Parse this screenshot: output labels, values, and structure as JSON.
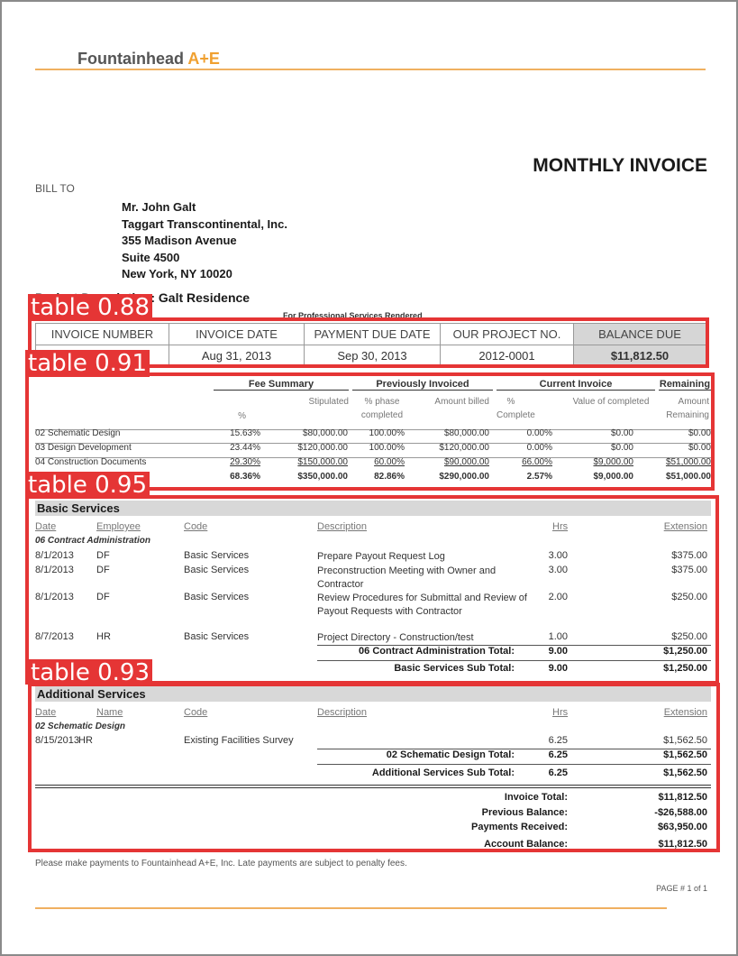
{
  "company": {
    "name": "Fountainhead",
    "accent": "A+E"
  },
  "doc_title": "MONTHLY INVOICE",
  "bill_to_label": "BILL TO",
  "address": [
    "Mr. John Galt",
    "Taggart Transcontinental, Inc.",
    "355 Madison Avenue",
    "Suite 4500",
    "New York,  NY  10020"
  ],
  "project_line": "Project Description: Galt Residence",
  "services_caption": "For Professional Services Rendered",
  "info": {
    "headers": [
      "INVOICE NUMBER",
      "INVOICE DATE",
      "PAYMENT DUE DATE",
      "OUR PROJECT NO.",
      "BALANCE DUE"
    ],
    "values": [
      "",
      "Aug 31, 2013",
      "Sep 30, 2013",
      "2012-0001",
      "$11,812.50"
    ]
  },
  "fee": {
    "groups": [
      "Fee Summary",
      "Previously Invoiced",
      "Current Invoice",
      "Remaining"
    ],
    "subheads": {
      "pct": "%",
      "stipulated": "Stipulated",
      "phase": "% phase completed",
      "amount_billed": "Amount billed",
      "complete": "% Complete",
      "value_completed": "Value of completed",
      "amount_remaining": "Amount Remaining"
    },
    "rows": [
      [
        "02 Schematic Design",
        "15.63%",
        "$80,000.00",
        "100.00%",
        "$80,000.00",
        "0.00%",
        "$0.00",
        "$0.00"
      ],
      [
        "03 Design Development",
        "23.44%",
        "$120,000.00",
        "100.00%",
        "$120,000.00",
        "0.00%",
        "$0.00",
        "$0.00"
      ],
      [
        "04 Construction Documents",
        "29.30%",
        "$150,000.00",
        "60.00%",
        "$90,000.00",
        "66.00%",
        "$9,000.00",
        "$51,000.00"
      ]
    ],
    "total": [
      "",
      "68.36%",
      "$350,000.00",
      "82.86%",
      "$290,000.00",
      "2.57%",
      "$9,000.00",
      "$51,000.00"
    ]
  },
  "basic": {
    "title": "Basic Services",
    "colheads": {
      "date": "Date",
      "employee": "Employee",
      "code": "Code",
      "description": "Description",
      "hrs": "Hrs",
      "extension": "Extension"
    },
    "category": "06 Contract Administration",
    "rows": [
      {
        "date": "8/1/2013",
        "emp": "DF",
        "code": "Basic Services",
        "desc": "Prepare Payout Request Log",
        "hrs": "3.00",
        "ext": "$375.00"
      },
      {
        "date": "8/1/2013",
        "emp": "DF",
        "code": "Basic Services",
        "desc": "Preconstruction Meeting with Owner and Contractor",
        "hrs": "3.00",
        "ext": "$375.00"
      },
      {
        "date": "8/1/2013",
        "emp": "DF",
        "code": "Basic Services",
        "desc": "Review Procedures for Submittal and Review of Payout Requests with Contractor",
        "hrs": "2.00",
        "ext": "$250.00"
      },
      {
        "date": "8/7/2013",
        "emp": "HR",
        "code": "Basic Services",
        "desc": "Project Directory - Construction/test",
        "hrs": "1.00",
        "ext": "$250.00"
      }
    ],
    "cat_total": {
      "label": "06 Contract Administration Total:",
      "hrs": "9.00",
      "ext": "$1,250.00"
    },
    "sub_total": {
      "label": "Basic Services Sub Total:",
      "hrs": "9.00",
      "ext": "$1,250.00"
    }
  },
  "additional": {
    "title": "Additional Services",
    "colheads": {
      "date": "Date",
      "name": "Name",
      "code": "Code",
      "description": "Description",
      "hrs": "Hrs",
      "extension": "Extension"
    },
    "category": "02 Schematic Design",
    "rows": [
      {
        "date": "8/15/2013",
        "emp": "HR",
        "code": "Existing Facilities Survey",
        "desc": "",
        "hrs": "6.25",
        "ext": "$1,562.50"
      }
    ],
    "cat_total": {
      "label": "02 Schematic Design Total:",
      "hrs": "6.25",
      "ext": "$1,562.50"
    },
    "sub_total": {
      "label": "Additional Services Sub Total:",
      "hrs": "6.25",
      "ext": "$1,562.50"
    }
  },
  "summary": {
    "invoice_total": {
      "label": "Invoice Total:",
      "value": "$11,812.50"
    },
    "previous_balance": {
      "label": "Previous Balance:",
      "value": "-$26,588.00"
    },
    "payments_received": {
      "label": "Payments Received:",
      "value": "$63,950.00"
    },
    "account_balance": {
      "label": "Account Balance:",
      "value": "$11,812.50"
    }
  },
  "footer_note": "Please make payments to Fountainhead A+E, Inc. Late payments are subject to penalty fees.",
  "page_num": "PAGE # 1 of 1",
  "detections": [
    {
      "label": "table 0.88"
    },
    {
      "label": "table 0.91"
    },
    {
      "label": "table 0.95"
    },
    {
      "label": "table 0.93"
    }
  ],
  "colors": {
    "detection": "#e53535",
    "brand_accent": "#f0a030",
    "rule": "#f0b060"
  }
}
